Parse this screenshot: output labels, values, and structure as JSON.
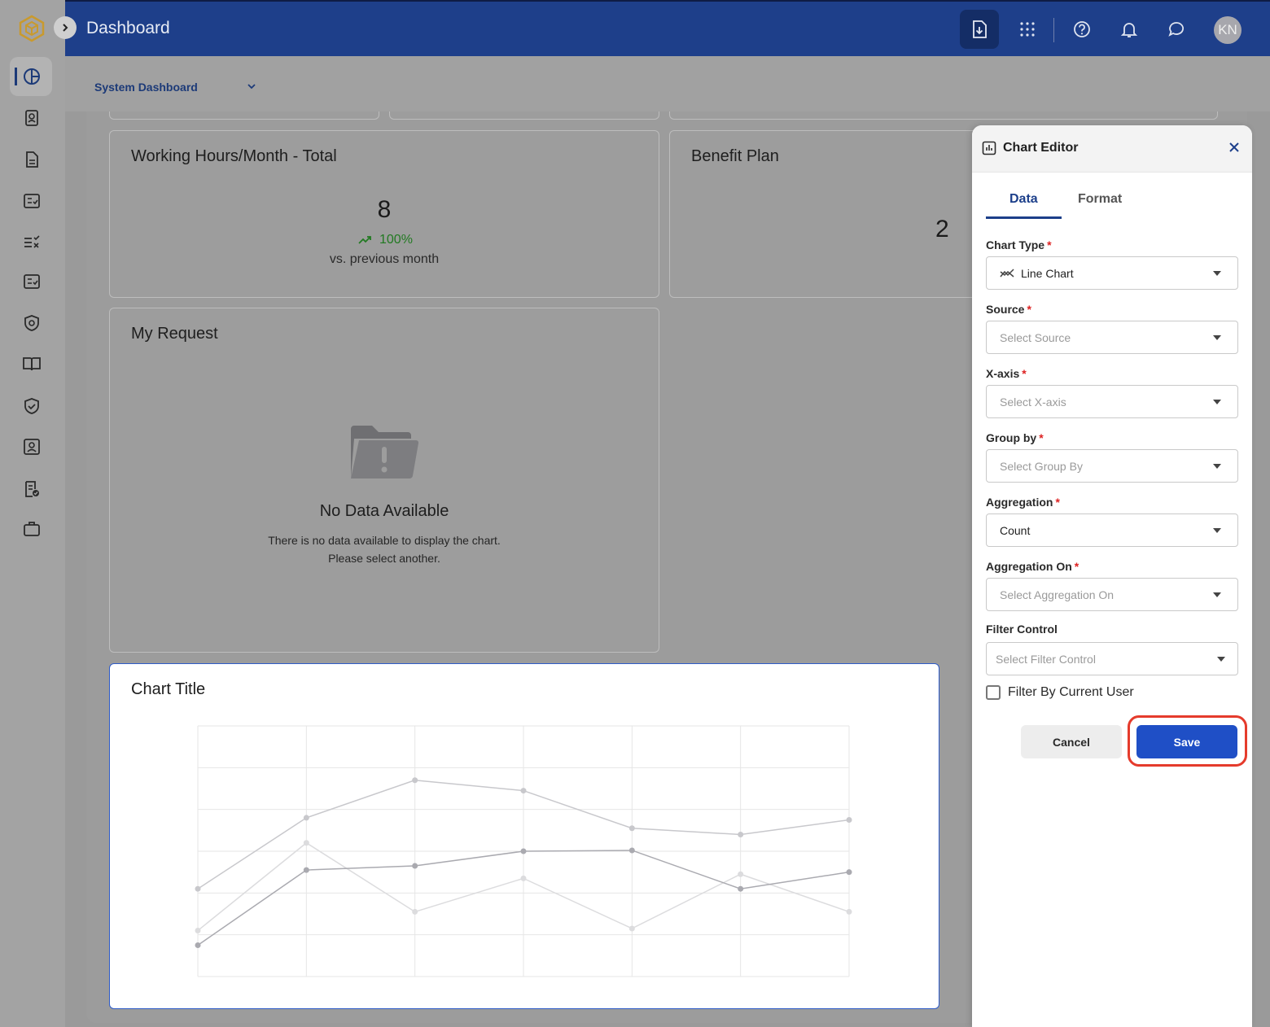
{
  "header": {
    "title": "Dashboard",
    "avatar_initials": "KN"
  },
  "subheader": {
    "dashboard_select": "System Dashboard"
  },
  "cards": {
    "working_hours": {
      "title": "Working Hours/Month - Total",
      "value": "8",
      "trend": "100%",
      "comparison": "vs. previous month"
    },
    "benefit_plan": {
      "title": "Benefit Plan",
      "value": "2"
    },
    "my_request": {
      "title": "My Request",
      "empty_title": "No Data Available",
      "empty_line1": "There is no data available to display the chart.",
      "empty_line2": "Please select another."
    },
    "chart": {
      "title": "Chart Title"
    }
  },
  "chart_data": {
    "type": "line",
    "x": [
      0,
      1,
      2,
      3,
      4,
      5,
      6
    ],
    "ylim": [
      0,
      6
    ],
    "grid": true,
    "series": [
      {
        "values": [
          2.1,
          3.8,
          4.7,
          4.45,
          3.55,
          3.4,
          3.75
        ],
        "color": "#c8c8cc"
      },
      {
        "values": [
          1.1,
          3.2,
          1.55,
          2.35,
          1.15,
          2.45,
          1.55
        ],
        "color": "#dcdcde"
      },
      {
        "values": [
          0.75,
          2.55,
          2.65,
          3.0,
          3.02,
          2.1,
          2.5
        ],
        "color": "#aaaab0"
      }
    ]
  },
  "editor": {
    "title": "Chart Editor",
    "tabs": [
      "Data",
      "Format"
    ],
    "fields": [
      {
        "label": "Chart Type",
        "required": true,
        "value": "Line Chart",
        "placeholder": ""
      },
      {
        "label": "Source",
        "required": true,
        "value": "",
        "placeholder": "Select Source"
      },
      {
        "label": "X-axis",
        "required": true,
        "value": "",
        "placeholder": "Select X-axis"
      },
      {
        "label": "Group by",
        "required": true,
        "value": "",
        "placeholder": "Select Group By"
      },
      {
        "label": "Aggregation",
        "required": true,
        "value": "Count",
        "placeholder": ""
      },
      {
        "label": "Aggregation On",
        "required": true,
        "value": "",
        "placeholder": "Select Aggregation On"
      },
      {
        "label": "Filter Control",
        "required": false,
        "value": "",
        "placeholder": "Select Filter Control"
      }
    ],
    "required_mark": "*",
    "checkbox_label": "Filter By Current User",
    "cancel_label": "Cancel",
    "save_label": "Save"
  },
  "colors": {
    "header_bg": "#1e3f8a",
    "accent": "#1f4fc6",
    "highlight": "#e53b2c",
    "trend_up": "#227a22"
  },
  "icons": {
    "sidebar": [
      "dashboard-icon",
      "contact-card-icon",
      "document-icon",
      "checklist-icon",
      "task-check-icon",
      "report-check-icon",
      "security-badge-icon",
      "book-icon",
      "shield-check-icon",
      "profile-card-icon",
      "document-approved-icon",
      "briefcase-icon"
    ],
    "header": [
      "download-icon",
      "apps-grid-icon",
      "help-icon",
      "bell-icon",
      "chat-icon"
    ]
  }
}
